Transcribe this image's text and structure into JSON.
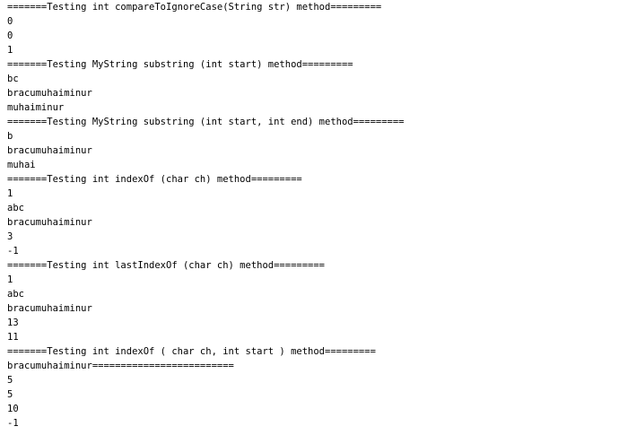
{
  "console": {
    "lines": [
      "=======Testing int compareToIgnoreCase(String str) method=========",
      "0",
      "0",
      "1",
      "=======Testing MyString substring (int start) method=========",
      "bc",
      "bracumuhaiminur",
      "muhaiminur",
      "=======Testing MyString substring (int start, int end) method=========",
      "b",
      "bracumuhaiminur",
      "muhai",
      "=======Testing int indexOf (char ch) method=========",
      "1",
      "abc",
      "bracumuhaiminur",
      "3",
      "-1",
      "=======Testing int lastIndexOf (char ch) method=========",
      "1",
      "abc",
      "bracumuhaiminur",
      "13",
      "11",
      "=======Testing int indexOf ( char ch, int start ) method=========",
      "bracumuhaiminur=========================",
      "5",
      "5",
      "10",
      "-1"
    ]
  }
}
